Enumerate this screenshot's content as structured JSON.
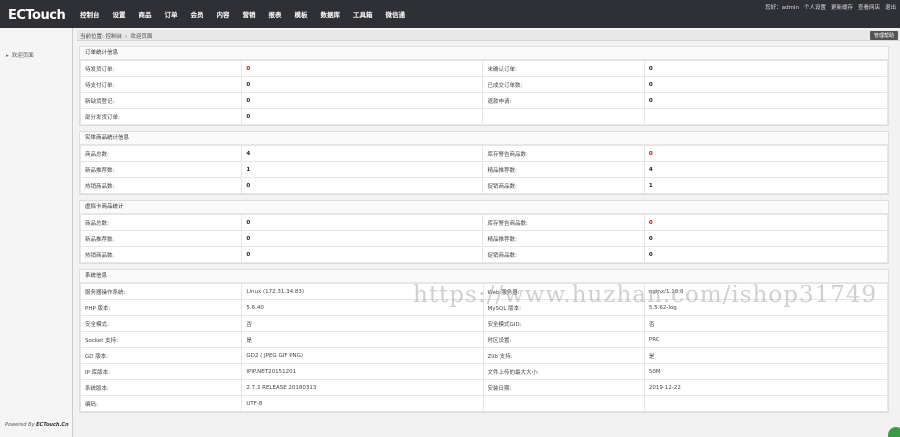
{
  "logo": {
    "text": "ECTouch"
  },
  "nav": [
    "控制台",
    "设置",
    "商品",
    "订单",
    "会员",
    "内容",
    "营销",
    "报表",
    "模板",
    "数据库",
    "工具箱",
    "微信通"
  ],
  "user_links": [
    "您好：admin",
    "个人设置",
    "更新缓存",
    "查看网店",
    "退出"
  ],
  "sidebar": {
    "item": "欢迎页面",
    "powered_prefix": "Powered By",
    "powered_brand": "ECTouch.Cn"
  },
  "breadcrumb": {
    "prefix": "当前位置:",
    "home": "控制台",
    "sep": "›",
    "current": "欢迎页面"
  },
  "manual_button": "管理帮助",
  "panels": [
    {
      "title": "订单统计信息",
      "rows": [
        [
          {
            "l": "待发货订单:",
            "v": "0",
            "red": true
          },
          {
            "l": "未确认订单:",
            "v": "0"
          }
        ],
        [
          {
            "l": "待支付订单:",
            "v": "0"
          },
          {
            "l": "已成交订单数:",
            "v": "0"
          }
        ],
        [
          {
            "l": "新缺货登记:",
            "v": "0"
          },
          {
            "l": "退款申请:",
            "v": "0"
          }
        ],
        [
          {
            "l": "部分发货订单:",
            "v": "0"
          },
          {
            "l": "",
            "v": ""
          }
        ]
      ]
    },
    {
      "title": "实体商品统计信息",
      "rows": [
        [
          {
            "l": "商品总数:",
            "v": "4"
          },
          {
            "l": "库存警告商品数:",
            "v": "0",
            "red": true
          }
        ],
        [
          {
            "l": "新品推荐数:",
            "v": "1"
          },
          {
            "l": "精品推荐数:",
            "v": "4"
          }
        ],
        [
          {
            "l": "热销商品数:",
            "v": "0"
          },
          {
            "l": "促销商品数:",
            "v": "1"
          }
        ]
      ]
    },
    {
      "title": "虚拟卡商品统计",
      "rows": [
        [
          {
            "l": "商品总数:",
            "v": "0"
          },
          {
            "l": "库存警告商品数:",
            "v": "0",
            "red": true
          }
        ],
        [
          {
            "l": "新品推荐数:",
            "v": "0"
          },
          {
            "l": "精品推荐数:",
            "v": "0"
          }
        ],
        [
          {
            "l": "热销商品数:",
            "v": "0"
          },
          {
            "l": "促销商品数:",
            "v": "0"
          }
        ]
      ]
    },
    {
      "title": "系统信息",
      "plain": true,
      "rows": [
        [
          {
            "l": "服务器操作系统:",
            "v": "Linux (172.31.34.83)"
          },
          {
            "l": "Web 服务器:",
            "v": "nginx/1.16.0"
          }
        ],
        [
          {
            "l": "PHP 版本:",
            "v": "5.6.40"
          },
          {
            "l": "MySQL 版本:",
            "v": "5.5.62-log"
          }
        ],
        [
          {
            "l": "安全模式:",
            "v": "否"
          },
          {
            "l": "安全模式GID:",
            "v": "否"
          }
        ],
        [
          {
            "l": "Socket 支持:",
            "v": "是"
          },
          {
            "l": "时区设置:",
            "v": "PRC"
          }
        ],
        [
          {
            "l": "GD 版本:",
            "v": "GD2 ( JPEG GIF PNG)"
          },
          {
            "l": "Zlib 支持:",
            "v": "是"
          }
        ],
        [
          {
            "l": "IP 库版本:",
            "v": "IPIP.NET20151201"
          },
          {
            "l": "文件上传的最大大小:",
            "v": "50M"
          }
        ],
        [
          {
            "l": "系统版本:",
            "v": "2.7.3 RELEASE 20180313"
          },
          {
            "l": "安装日期:",
            "v": "2019-12-22"
          }
        ],
        [
          {
            "l": "编码:",
            "v": "UTF-8"
          },
          {
            "l": "",
            "v": ""
          }
        ]
      ]
    }
  ],
  "watermark": "https://www.huzhan.com/ishop31749",
  "colors": {
    "topbar": "#2f3035",
    "warning": "#dd0000"
  }
}
